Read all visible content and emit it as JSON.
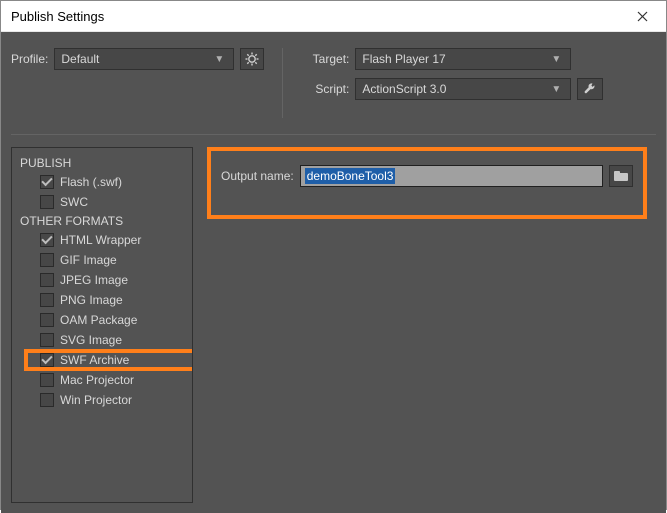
{
  "window": {
    "title": "Publish Settings"
  },
  "profile": {
    "label": "Profile:",
    "value": "Default"
  },
  "target": {
    "label": "Target:",
    "value": "Flash Player 17"
  },
  "script": {
    "label": "Script:",
    "value": "ActionScript 3.0"
  },
  "output": {
    "label": "Output name:",
    "value": "demoBoneTool3"
  },
  "sections": {
    "publish": "PUBLISH",
    "other": "OTHER FORMATS"
  },
  "formats": {
    "flash": {
      "label": "Flash (.swf)",
      "checked": true
    },
    "swc": {
      "label": "SWC",
      "checked": false
    },
    "html": {
      "label": "HTML Wrapper",
      "checked": true
    },
    "gif": {
      "label": "GIF Image",
      "checked": false
    },
    "jpeg": {
      "label": "JPEG Image",
      "checked": false
    },
    "png": {
      "label": "PNG Image",
      "checked": false
    },
    "oam": {
      "label": "OAM Package",
      "checked": false
    },
    "svg": {
      "label": "SVG Image",
      "checked": false
    },
    "swfarchive": {
      "label": "SWF Archive",
      "checked": true
    },
    "mac": {
      "label": "Mac Projector",
      "checked": false
    },
    "win": {
      "label": "Win Projector",
      "checked": false
    }
  }
}
